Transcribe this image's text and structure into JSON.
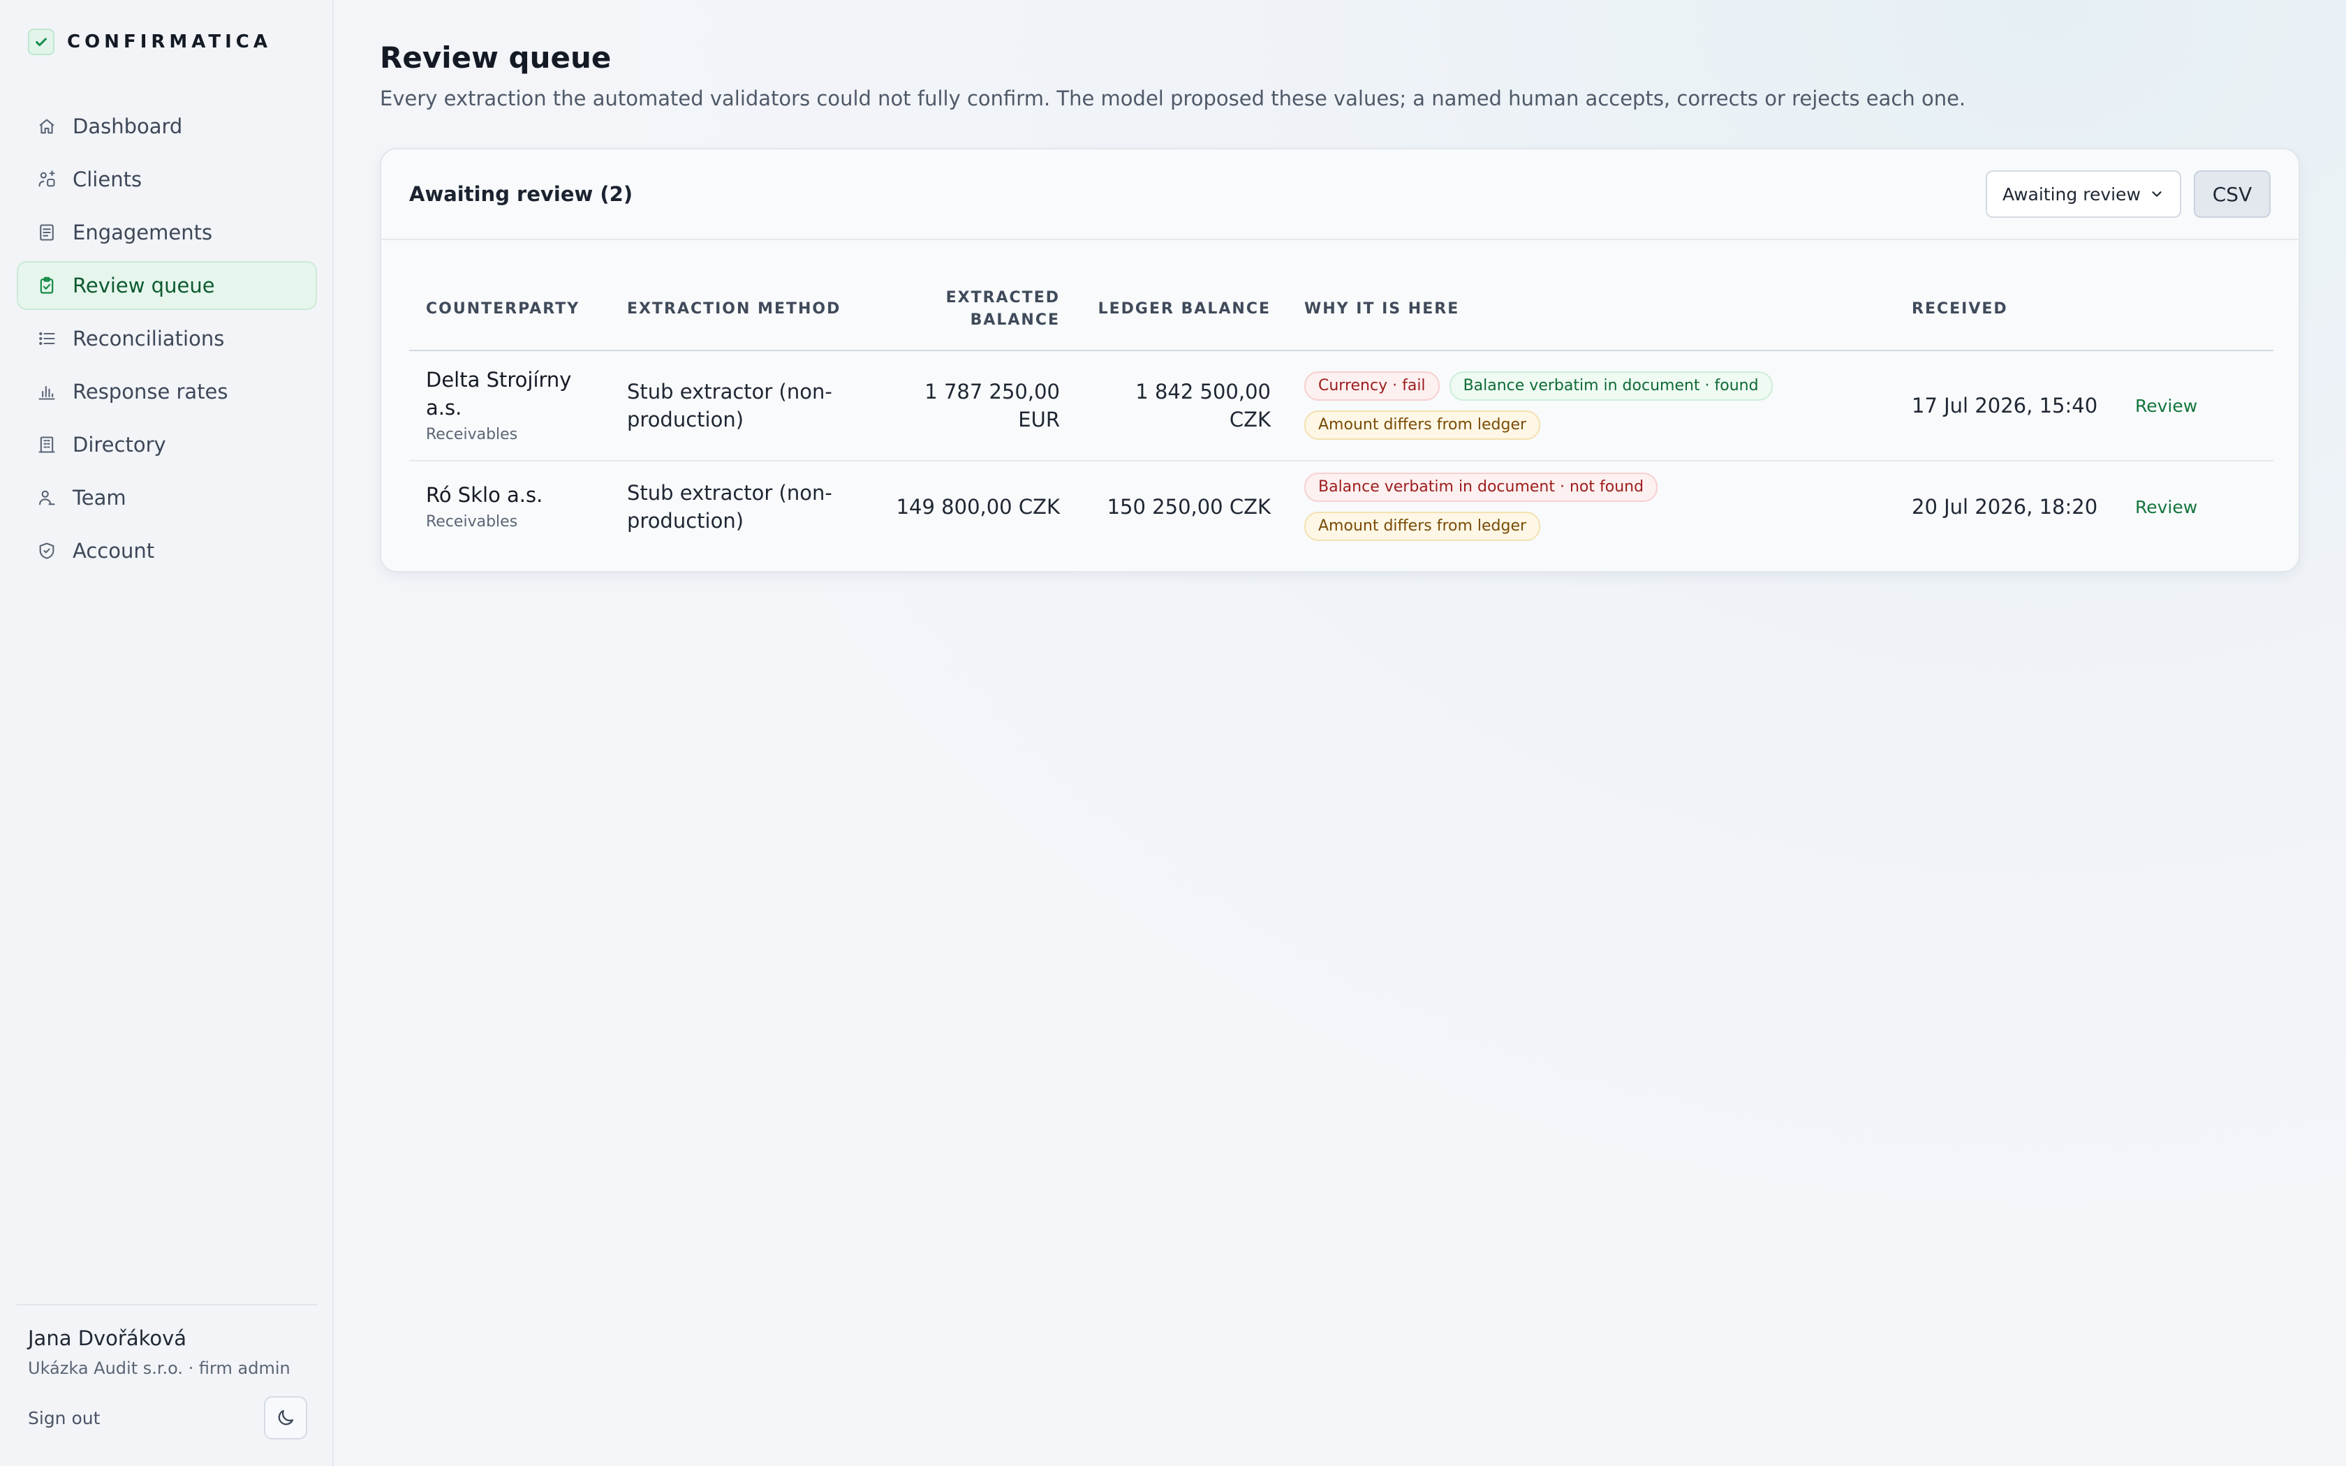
{
  "brand": {
    "name": "CONFIRMATICA",
    "icon": "check-icon"
  },
  "nav": [
    {
      "label": "Dashboard",
      "icon": "home-icon",
      "active": false
    },
    {
      "label": "Clients",
      "icon": "users-icon",
      "active": false
    },
    {
      "label": "Engagements",
      "icon": "document-icon",
      "active": false
    },
    {
      "label": "Review queue",
      "icon": "clipboard-check-icon",
      "active": true
    },
    {
      "label": "Reconciliations",
      "icon": "list-icon",
      "active": false
    },
    {
      "label": "Response rates",
      "icon": "bar-chart-icon",
      "active": false
    },
    {
      "label": "Directory",
      "icon": "building-icon",
      "active": false
    },
    {
      "label": "Team",
      "icon": "team-icon",
      "active": false
    },
    {
      "label": "Account",
      "icon": "shield-icon",
      "active": false
    }
  ],
  "user": {
    "name": "Jana Dvořáková",
    "org": "Ukázka Audit s.r.o. · firm admin",
    "sign_out": "Sign out"
  },
  "page": {
    "title": "Review queue",
    "subtitle": "Every extraction the automated validators could not fully confirm. The model proposed these values; a named human accepts, corrects or rejects each one."
  },
  "card": {
    "title": "Awaiting review (2)",
    "filter": "Awaiting review",
    "csv_label": "CSV"
  },
  "table": {
    "headers": {
      "counterparty": "COUNTERPARTY",
      "method": "EXTRACTION METHOD",
      "extracted_1": "EXTRACTED",
      "extracted_2": "BALANCE",
      "ledger": "LEDGER BALANCE",
      "why": "WHY IT IS HERE",
      "received": "RECEIVED"
    },
    "rows": [
      {
        "name_1": "Delta Strojírny",
        "name_2": "a.s.",
        "type": "Receivables",
        "method_1": "Stub extractor (non-",
        "method_2": "production)",
        "extracted": "1 787 250,00 EUR",
        "ledger": "1 842 500,00 CZK",
        "chips": [
          {
            "text": "Currency · fail",
            "status": "red"
          },
          {
            "text": "Balance verbatim in document · found",
            "status": "green"
          },
          {
            "text": "Amount differs from ledger",
            "status": "amber"
          }
        ],
        "received": "17 Jul 2026, 15:40",
        "action": "Review"
      },
      {
        "name_1": "Ró Sklo a.s.",
        "type": "Receivables",
        "method_1": "Stub extractor (non-",
        "method_2": "production)",
        "extracted": "149 800,00 CZK",
        "ledger": "150 250,00 CZK",
        "chips": [
          {
            "text": "Balance verbatim in document · not found",
            "status": "red"
          },
          {
            "text": "Amount differs from ledger",
            "status": "amber"
          }
        ],
        "received": "20 Jul 2026, 18:20",
        "action": "Review"
      }
    ]
  },
  "colors": {
    "accent": "#13743c",
    "active_nav_bg": "#e6f6ec",
    "chip_red": "#9d1c1c",
    "chip_green": "#0f6a35",
    "chip_amber": "#7a4b05"
  }
}
